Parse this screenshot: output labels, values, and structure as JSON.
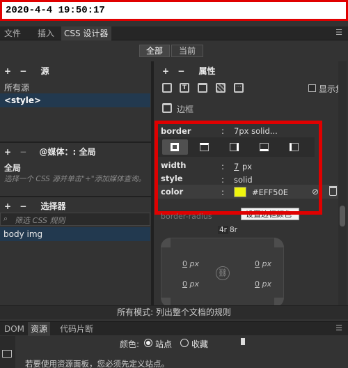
{
  "timestamp": "2020-4-4 19:50:17",
  "tabs": [
    {
      "label": "文件"
    },
    {
      "label": "插入"
    },
    {
      "label": "CSS 设计器"
    }
  ],
  "tab_menu_icon": "menu-icon",
  "modes": {
    "all": "全部",
    "current": "当前"
  },
  "sources": {
    "title": "源",
    "items": [
      "所有源",
      "<style>"
    ]
  },
  "media": {
    "title": "@媒体：: 全局",
    "global": "全局",
    "hint": "选择一个 CSS 源并单击\"+\"添加媒体查询。"
  },
  "selectors": {
    "title": "选择器",
    "filter_placeholder": "筛选 CSS 规则",
    "items": [
      "body img"
    ]
  },
  "properties": {
    "title": "属性",
    "show_set_label": "显示集",
    "section": "边框",
    "border": {
      "name": "border",
      "value": "7px solid..."
    },
    "width": {
      "name": "width",
      "value": "7",
      "unit": "px"
    },
    "style": {
      "name": "style",
      "value": "solid"
    },
    "color": {
      "name": "color",
      "value": "#EFF50E"
    },
    "tooltip": "设置边框颜色",
    "border_radius_label": "border-radius",
    "radius_modes": [
      "4r",
      "8r"
    ],
    "radius_values": [
      {
        "v": "0",
        "u": "px"
      },
      {
        "v": "0",
        "u": "px"
      },
      {
        "v": "0",
        "u": "px"
      },
      {
        "v": "0",
        "u": "px"
      }
    ]
  },
  "status": "所有模式: 列出整个文档的规则",
  "bottom_tabs": [
    {
      "label": "DOM"
    },
    {
      "label": "资源"
    },
    {
      "label": "代码片断"
    }
  ],
  "assets": {
    "color_label": "颜色:",
    "site": "站点",
    "favorites": "收藏",
    "message": "若要使用资源面板，您必须先定义站点。"
  },
  "colors": {
    "accent": "#e00000",
    "swatch": "#EFF50E",
    "selected": "#22394f"
  }
}
